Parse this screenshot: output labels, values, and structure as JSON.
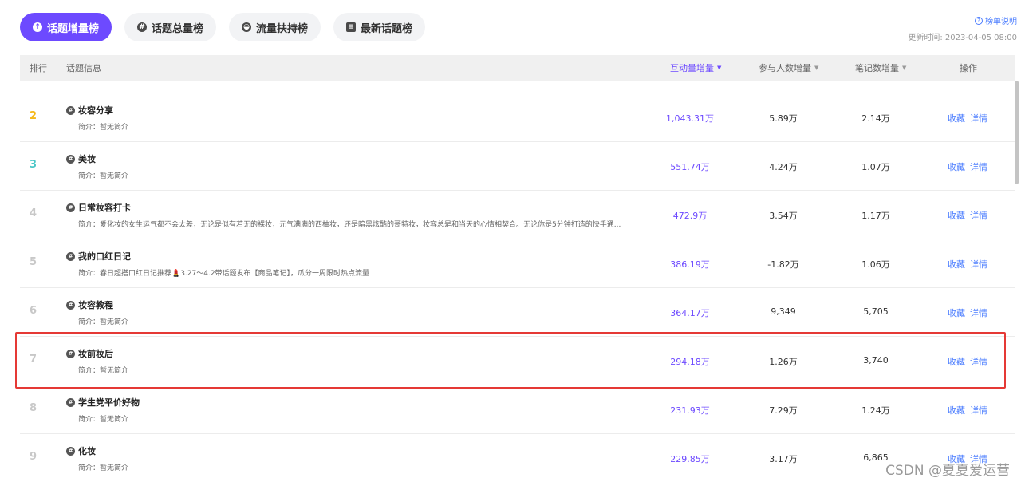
{
  "tabs": [
    {
      "label": "话题增量榜",
      "icon": "arrow-up-icon",
      "active": true
    },
    {
      "label": "话题总量榜",
      "icon": "hash-icon",
      "active": false
    },
    {
      "label": "流量扶持榜",
      "icon": "bowl-icon",
      "active": false
    },
    {
      "label": "最新话题榜",
      "icon": "comment-icon",
      "active": false
    }
  ],
  "header_right": {
    "explain_label": "榜单说明",
    "updated_label": "更新时间: 2023-04-05 08:00"
  },
  "table": {
    "columns": {
      "rank": "排行",
      "topic": "话题信息",
      "interaction": "互动量增量",
      "participants": "参与人数增量",
      "notes": "笔记数增量",
      "actions": "操作"
    },
    "rows": [
      {
        "rank": "2",
        "name": "妆容分享",
        "intro": "简介：暂无简介",
        "interaction": "1,043.31万",
        "participants": "5.89万",
        "notes": "2.14万",
        "fav": "收藏",
        "detail": "详情"
      },
      {
        "rank": "3",
        "name": "美妆",
        "intro": "简介：暂无简介",
        "interaction": "551.74万",
        "participants": "4.24万",
        "notes": "1.07万",
        "fav": "收藏",
        "detail": "详情"
      },
      {
        "rank": "4",
        "name": "日常妆容打卡",
        "intro": "简介：爱化妆的女生运气都不会太差，无论是似有若无的裸妆，元气满满的西柚妆，还是暗黑炫酷的哥特妆，妆容总是和当天的心情相契合。无论你是5分钟打造的快手通...",
        "interaction": "472.9万",
        "participants": "3.54万",
        "notes": "1.17万",
        "fav": "收藏",
        "detail": "详情"
      },
      {
        "rank": "5",
        "name": "我的口红日记",
        "intro": "简介：春日超搭口红日记推荐💄3.27～4.2带话题发布【商品笔记】，瓜分一周限时热点流量",
        "interaction": "386.19万",
        "participants": "-1.82万",
        "notes": "1.06万",
        "fav": "收藏",
        "detail": "详情"
      },
      {
        "rank": "6",
        "name": "妆容教程",
        "intro": "简介：暂无简介",
        "interaction": "364.17万",
        "participants": "9,349",
        "notes": "5,705",
        "fav": "收藏",
        "detail": "详情"
      },
      {
        "rank": "7",
        "name": "妆前妆后",
        "intro": "简介：暂无简介",
        "interaction": "294.18万",
        "participants": "1.26万",
        "notes": "3,740",
        "fav": "收藏",
        "detail": "详情"
      },
      {
        "rank": "8",
        "name": "学生党平价好物",
        "intro": "简介：暂无简介",
        "interaction": "231.93万",
        "participants": "7.29万",
        "notes": "1.24万",
        "fav": "收藏",
        "detail": "详情"
      },
      {
        "rank": "9",
        "name": "化妆",
        "intro": "简介：暂无简介",
        "interaction": "229.85万",
        "participants": "3.17万",
        "notes": "6,865",
        "fav": "收藏",
        "detail": "详情"
      }
    ]
  },
  "watermark": "CSDN @夏夏爱运营",
  "colors": {
    "accent": "#6d4aff",
    "link": "#4a7cff",
    "rank2": "#f5b81a",
    "rank3": "#49c6c6",
    "highlight": "#e53935"
  }
}
